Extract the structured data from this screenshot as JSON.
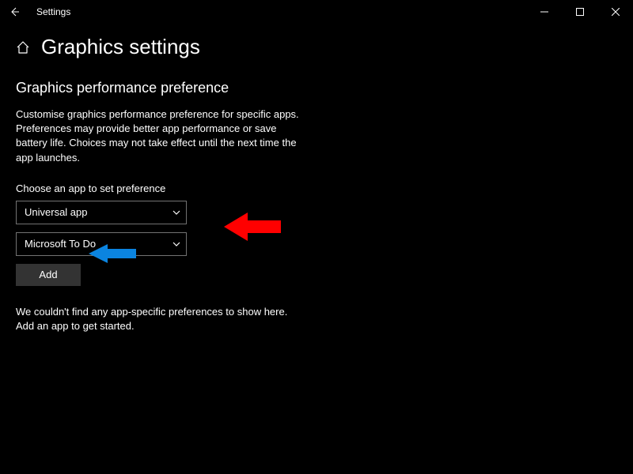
{
  "titlebar": {
    "label": "Settings"
  },
  "page": {
    "title": "Graphics settings"
  },
  "section": {
    "title": "Graphics performance preference",
    "description": "Customise graphics performance preference for specific apps. Preferences may provide better app performance or save battery life. Choices may not take effect until the next time the app launches."
  },
  "chooser": {
    "label": "Choose an app to set preference",
    "app_type": "Universal app",
    "app_name": "Microsoft To Do",
    "add_label": "Add"
  },
  "empty": "We couldn't find any app-specific preferences to show here. Add an app to get started.",
  "annotations": {
    "red_arrow": "red-arrow",
    "blue_arrow": "blue-arrow"
  }
}
